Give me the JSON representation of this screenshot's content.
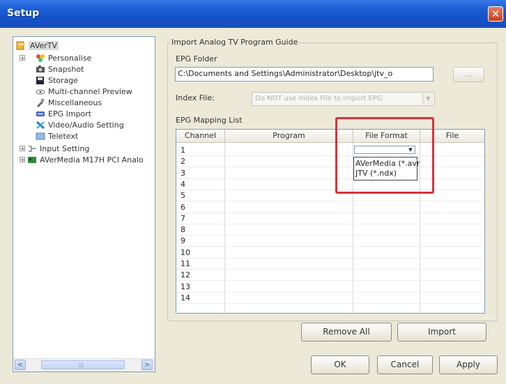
{
  "window": {
    "title": "Setup",
    "close_glyph": "✕"
  },
  "tree": {
    "root": "AVerTV",
    "items": [
      {
        "label": "Personalise",
        "icon": "personalise-icon",
        "expander": "+"
      },
      {
        "label": "Snapshot",
        "icon": "camera-icon"
      },
      {
        "label": "Storage",
        "icon": "disk-icon"
      },
      {
        "label": "Multi-channel Preview",
        "icon": "eye-icon"
      },
      {
        "label": "Miscellaneous",
        "icon": "tools-icon"
      },
      {
        "label": "EPG Import",
        "icon": "epg-icon"
      },
      {
        "label": "Video/Audio Setting",
        "icon": "wrench-icon"
      },
      {
        "label": "Teletext",
        "icon": "teletext-icon"
      },
      {
        "label": "Input Setting",
        "icon": "input-icon",
        "expander": "+"
      },
      {
        "label": "AVerMedia M17H PCI Analo",
        "icon": "card-icon",
        "expander": "+"
      }
    ],
    "scroll_left": "<",
    "scroll_right": ">",
    "scroll_thumb": "|||"
  },
  "panel": {
    "group_title": "Import Analog TV Program Guide",
    "epg_folder_label": "EPG Folder",
    "epg_folder_value": "C:\\Documents and Settings\\Administrator\\Desktop\\jtv_o",
    "browse_label": "...",
    "index_file_label": "Index File:",
    "index_file_value": "Do NOT use Index File to import EPG",
    "mapping_list_label": "EPG Mapping List",
    "columns": [
      "Channel",
      "Program",
      "File Format",
      "File"
    ],
    "rows": [
      "1",
      "2",
      "3",
      "4",
      "5",
      "6",
      "7",
      "8",
      "9",
      "10",
      "11",
      "12",
      "13",
      "14"
    ],
    "format_options": [
      "AVerMedia (*.avr",
      "JTV (*.ndx)"
    ],
    "dropdown_arrow": "▼",
    "remove_all_label": "Remove All",
    "import_label": "Import"
  },
  "footer": {
    "ok_label": "OK",
    "cancel_label": "Cancel",
    "apply_label": "Apply"
  },
  "colors": {
    "highlight": "#d8323a",
    "title_bar": "#1d5fd6"
  }
}
